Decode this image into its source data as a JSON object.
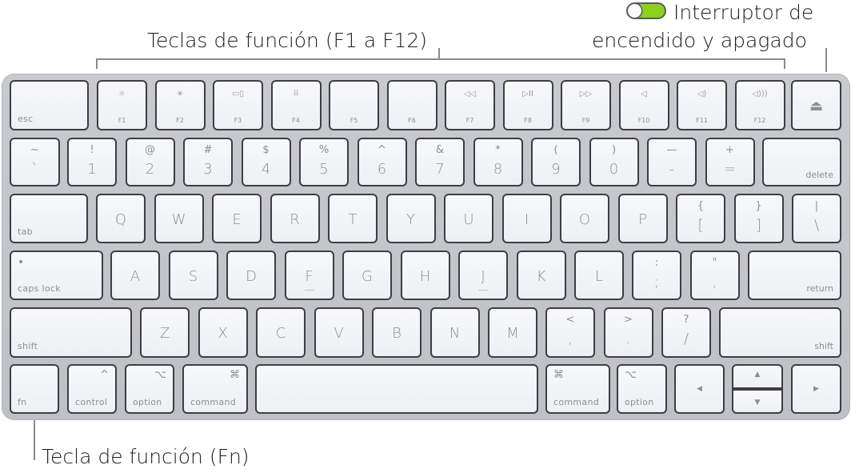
{
  "callouts": {
    "function_keys": "Teclas de función (F1 a F12)",
    "power_line1": "Interruptor de",
    "power_line2": "encendido y apagado",
    "fn_key": "Tecla de función (Fn)"
  },
  "toggle": {
    "state": "on",
    "color": "#8dd11a"
  },
  "keys": {
    "esc": "esc",
    "f1": "F1",
    "f2": "F2",
    "f3": "F3",
    "f4": "F4",
    "f5": "F5",
    "f6": "F6",
    "f7": "F7",
    "f8": "F8",
    "f9": "F9",
    "f10": "F10",
    "f11": "F11",
    "f12": "F12",
    "f1_icon": "☼",
    "f2_icon": "☀",
    "f3_icon": "▭▯",
    "f4_icon": "⠿",
    "f7_icon": "◁◁",
    "f8_icon": "▷II",
    "f9_icon": "▷▷",
    "f10_icon": "◁",
    "f11_icon": "◁)",
    "f12_icon": "◁)))",
    "eject_icon": "⏏",
    "number_row": [
      {
        "up": "~",
        "dn": "`"
      },
      {
        "up": "!",
        "dn": "1"
      },
      {
        "up": "@",
        "dn": "2"
      },
      {
        "up": "#",
        "dn": "3"
      },
      {
        "up": "$",
        "dn": "4"
      },
      {
        "up": "%",
        "dn": "5"
      },
      {
        "up": "^",
        "dn": "6"
      },
      {
        "up": "&",
        "dn": "7"
      },
      {
        "up": "*",
        "dn": "8"
      },
      {
        "up": "(",
        "dn": "9"
      },
      {
        "up": ")",
        "dn": "0"
      },
      {
        "up": "—",
        "dn": "-"
      },
      {
        "up": "+",
        "dn": "="
      }
    ],
    "delete": "delete",
    "tab": "tab",
    "qwerty": [
      "Q",
      "W",
      "E",
      "R",
      "T",
      "Y",
      "U",
      "I",
      "O",
      "P"
    ],
    "brackets": [
      {
        "up": "{",
        "dn": "["
      },
      {
        "up": "}",
        "dn": "]"
      },
      {
        "up": "|",
        "dn": "\\"
      }
    ],
    "caps_lock": "caps lock",
    "asdf": [
      "A",
      "S",
      "D",
      "F",
      "G",
      "H",
      "J",
      "K",
      "L"
    ],
    "semi": [
      {
        "up": ":",
        "dn": ";"
      },
      {
        "up": "\"",
        "dn": ","
      }
    ],
    "return": "return",
    "shift": "shift",
    "zxcv": [
      "Z",
      "X",
      "C",
      "V",
      "B",
      "N",
      "M"
    ],
    "punct": [
      {
        "up": "<",
        "dn": ","
      },
      {
        "up": ">",
        "dn": "."
      },
      {
        "up": "?",
        "dn": "/"
      }
    ],
    "fn": "fn",
    "control": "control",
    "control_sym": "^",
    "option": "option",
    "option_sym": "⌥",
    "command": "command",
    "command_sym": "⌘",
    "arrow_left": "◀",
    "arrow_up": "▲",
    "arrow_down": "▼",
    "arrow_right": "▶"
  }
}
